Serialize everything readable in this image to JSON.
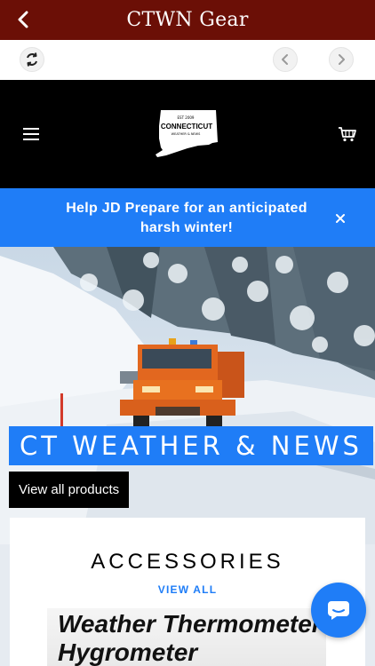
{
  "titlebar": {
    "title": "CTWN Gear"
  },
  "store": {
    "logo": {
      "est": "EST 2009",
      "name": "CONNECTICUT",
      "sub": "WEATHER & NEWS"
    }
  },
  "announcement": {
    "text": "Help JD Prepare for an anticipated harsh winter!"
  },
  "hero": {
    "title": "CT WEATHER & NEWS",
    "button_label": "View all products"
  },
  "collection": {
    "heading": "ACCESSORIES",
    "view_all": "VIEW ALL",
    "product_title_line1": "Weather Thermometer",
    "product_title_line2": "Hygrometer"
  },
  "colors": {
    "titlebar_bg": "#6b0f06",
    "accent_blue": "#1f7df7",
    "header_bg": "#000000"
  },
  "icons": {
    "back": "chevron-left-icon",
    "refresh": "refresh-icon",
    "prev": "chevron-left-icon",
    "next": "chevron-right-icon",
    "menu": "hamburger-icon",
    "cart": "cart-icon",
    "close": "close-icon",
    "chat": "chat-icon"
  }
}
